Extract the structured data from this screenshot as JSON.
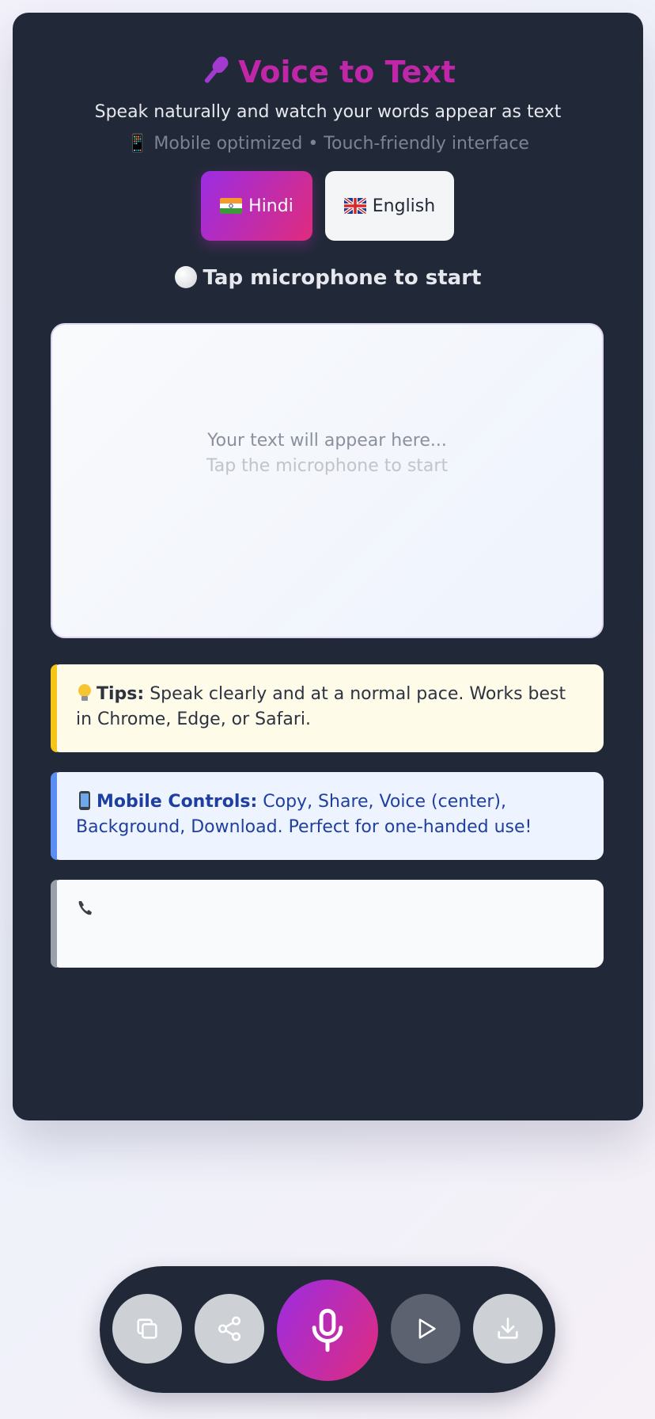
{
  "header": {
    "title": "Voice to Text",
    "title_icon": "microphone-icon",
    "subtitle": "Speak naturally and watch your words appear as text",
    "subtitle2": "📱 Mobile optimized • Touch-friendly interface"
  },
  "languages": {
    "hindi_label": "Hindi",
    "english_label": "English",
    "selected": "Hindi"
  },
  "status": {
    "text": "Tap microphone to start"
  },
  "transcript": {
    "placeholder_line1": "Your text will appear here...",
    "placeholder_line2": "Tap the microphone to start"
  },
  "tips": {
    "label": "Tips:",
    "text": " Speak clearly and at a normal pace. Works best in Chrome, Edge, or Safari."
  },
  "mobile_controls": {
    "label": "Mobile Controls:",
    "text": " Copy, Share, Voice (center), Background, Download. Perfect for one-handed use!"
  },
  "phone_box": {
    "text": ""
  },
  "toolbar": {
    "buttons": [
      "copy-icon",
      "share-icon",
      "microphone-icon",
      "play-icon",
      "download-icon"
    ]
  },
  "colors": {
    "card_bg": "#212938",
    "accent_start": "#9b2de3",
    "accent_end": "#e02b7c",
    "title": "#c026a8"
  }
}
